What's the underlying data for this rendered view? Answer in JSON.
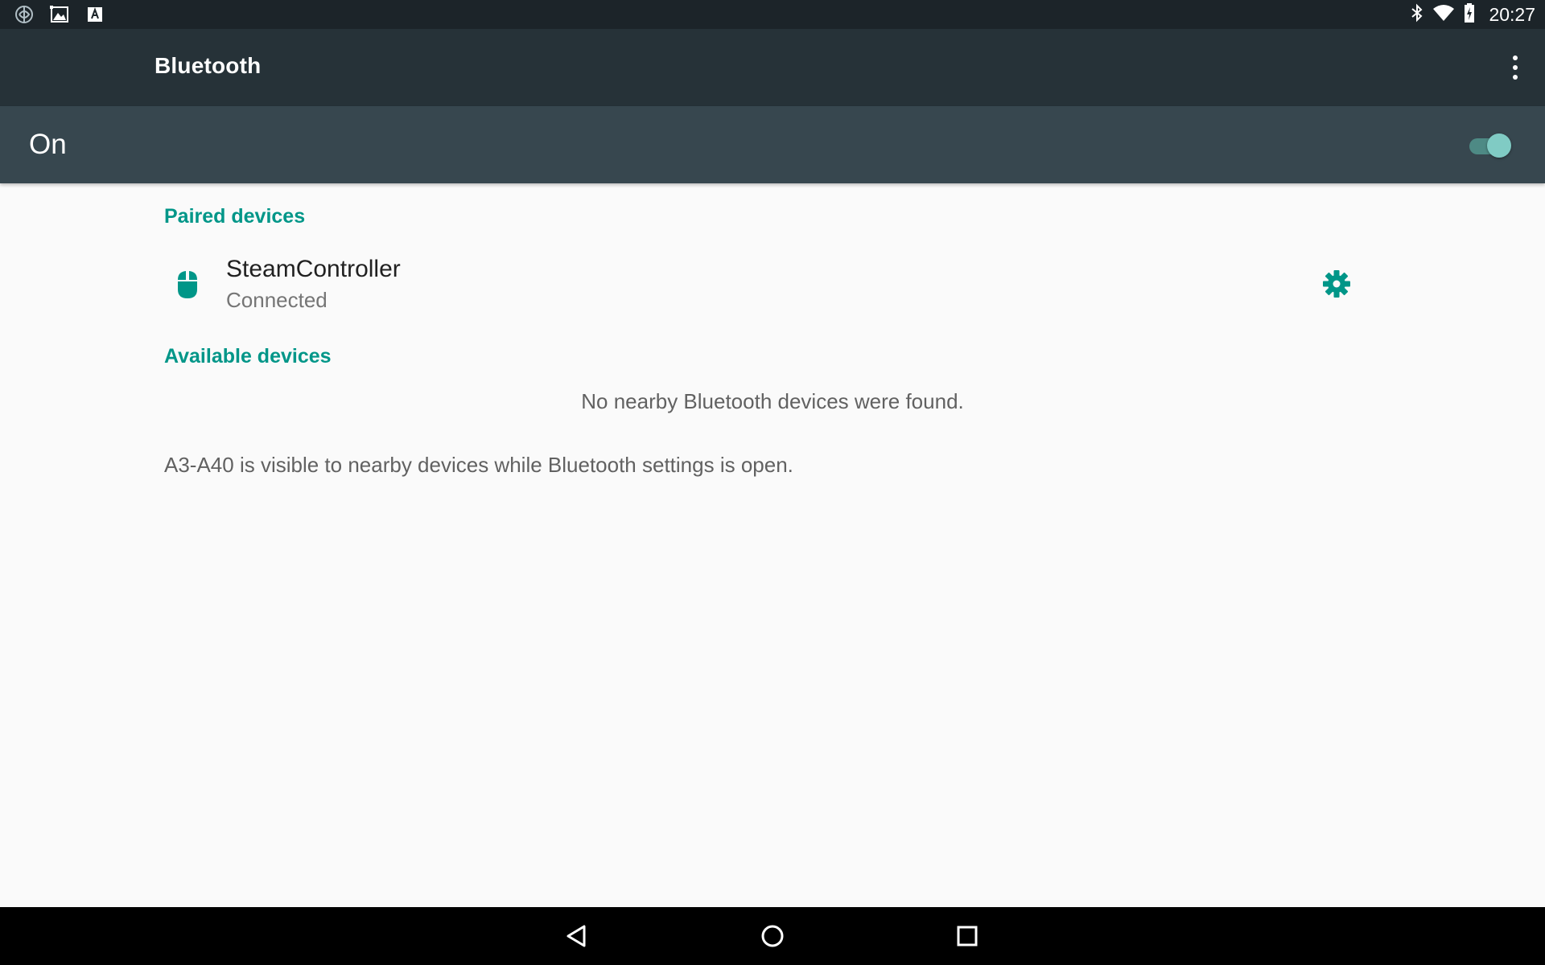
{
  "status_bar": {
    "time": "20:27",
    "left_icons": [
      "sync-icon",
      "photo-icon",
      "font-icon"
    ],
    "right_icons": [
      "bluetooth-icon",
      "wifi-icon",
      "battery-charging-icon"
    ]
  },
  "app_bar": {
    "title": "Bluetooth",
    "menu_icon": "overflow-menu-icon"
  },
  "main_switch": {
    "label": "On",
    "checked": true,
    "accent_color": "#80cbc4"
  },
  "paired": {
    "header": "Paired devices",
    "devices": [
      {
        "name": "SteamController",
        "status": "Connected",
        "icon": "mouse-icon",
        "action_icon": "gear-icon"
      }
    ]
  },
  "available": {
    "header": "Available devices",
    "empty_text": "No nearby Bluetooth devices were found."
  },
  "footer": {
    "visibility_text": "A3-A40 is visible to nearby devices while Bluetooth settings is open."
  },
  "nav_bar": {
    "buttons": [
      "back-icon",
      "home-icon",
      "recents-icon"
    ]
  },
  "colors": {
    "accent": "#009688",
    "app_bar": "#263238",
    "switch_bar": "#37474f",
    "status_bar": "#1c2429"
  }
}
